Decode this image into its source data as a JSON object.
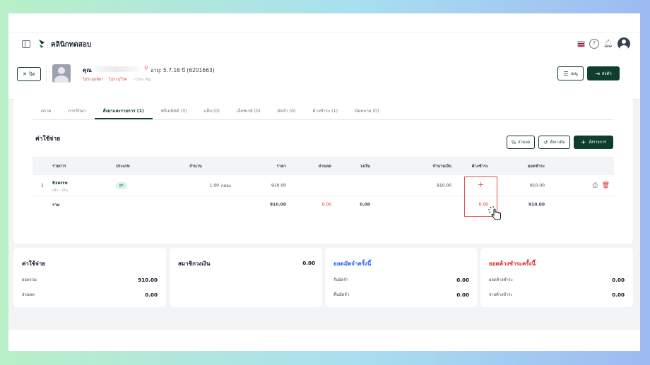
{
  "app": {
    "clinic_name": "คลินิกทดสอบ",
    "brand_color": "#0f3d2e"
  },
  "header": {
    "icons": [
      "sidebar-toggle-icon",
      "thai-flag-icon",
      "help-icon",
      "bell-icon",
      "user-avatar-icon"
    ]
  },
  "patient": {
    "close_label": "ปิด",
    "name_prefix": "คุณ",
    "age_text": "อายุ: 5.7.16 ปี",
    "hn_text": "(6201663)",
    "tag_allergy": "ไม่ระบุแพ้ยา",
    "tag_disease": "ไม่ระบุโรค",
    "tag_measure": "- Cm/- Kg",
    "menu_label": "เมนู",
    "send_label": "ส่งตัว"
  },
  "tabs": [
    {
      "label": "ตรวจ",
      "active": false
    },
    {
      "label": "การรักษา",
      "active": false
    },
    {
      "label": "สั่งยาและรายการ (1)",
      "active": true
    },
    {
      "label": "พรีเมนิทต์ (3)",
      "active": false
    },
    {
      "label": "แล็บ (0)",
      "active": false
    },
    {
      "label": "เอ็กซเรย์ (0)",
      "active": false
    },
    {
      "label": "มัดจำ (0)",
      "active": false
    },
    {
      "label": "ค้างชำระ (1)",
      "active": false
    },
    {
      "label": "นัดหมาย (0)",
      "active": false
    }
  ],
  "expenses": {
    "title": "ค่าใช้จ่าย",
    "btn_discount": "ส่วนลด",
    "btn_history": "สั่งยาเดิม",
    "btn_add": "สั่งรายการ",
    "columns": [
      "รายการ",
      "ประเภท",
      "จำนวน",
      "ราคา",
      "ส่วนลด",
      "วงเงิน",
      "จำนวนเงิน",
      "ค้างชำระ",
      "ยอดชำระ"
    ],
    "rows": [
      {
        "no": "1",
        "name": "Ezerro",
        "sub": "เช้า - เย็น",
        "type": "ยา",
        "qty": "1.00",
        "unit": "กล่อง",
        "price": "910.00",
        "discount": "",
        "limit": "",
        "amount": "910.00",
        "outstanding": "+",
        "paid": "910.00"
      }
    ],
    "total": {
      "label": "รวม",
      "price": "910.00",
      "discount": "0.00",
      "limit": "0.00",
      "amount": "",
      "outstanding": "0.00",
      "paid": "910.00"
    }
  },
  "summary": {
    "expense": {
      "title": "ค่าใช้จ่าย",
      "total_label": "ยอดรวม",
      "total_value": "910.00",
      "discount_label": "ส่วนลด",
      "discount_value": "0.00"
    },
    "wallet": {
      "title": "สมาชิกวงเงิน",
      "value": "0.00"
    },
    "deposit": {
      "title": "ยอดมัดจำครั้งนี้",
      "receive_label": "รับมัดจำ",
      "receive_value": "0.00",
      "refund_label": "คืนมัดจำ",
      "refund_value": "0.00"
    },
    "outstanding": {
      "title": "ยอดค้างชำระครั้งนี้",
      "pending_label": "ยอดค้างชำระ",
      "pending_value": "0.00",
      "pay_label": "จ่ายค้างชำระ",
      "pay_value": "0.00"
    }
  }
}
